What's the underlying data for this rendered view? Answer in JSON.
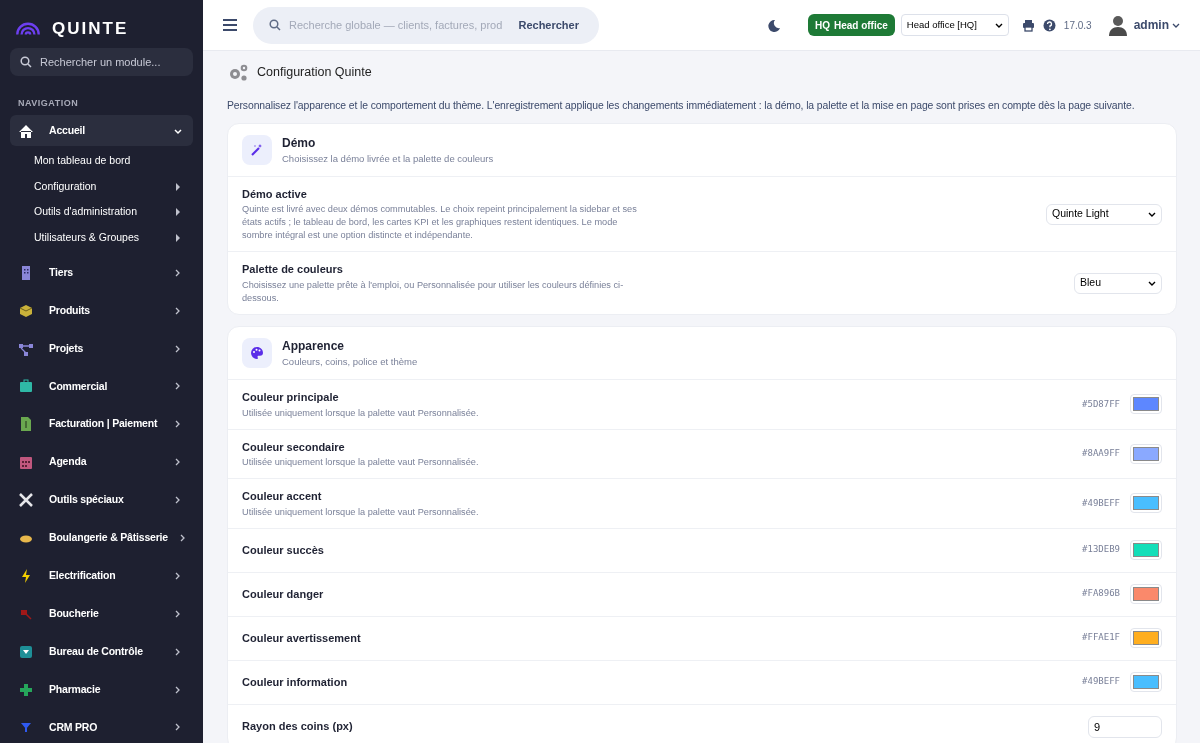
{
  "brand": {
    "name": "QUINTE"
  },
  "sidebar": {
    "search": {
      "placeholder": "Rechercher un module..."
    },
    "section_label": "NAVIGATION",
    "items": [
      {
        "label": "Accueil",
        "selected": true,
        "expanded": true,
        "children": [
          {
            "label": "Mon tableau de bord",
            "has_submenu": false
          },
          {
            "label": "Configuration",
            "has_submenu": true
          },
          {
            "label": "Outils d'administration",
            "has_submenu": true
          },
          {
            "label": "Utilisateurs & Groupes",
            "has_submenu": true
          }
        ]
      },
      {
        "label": "Tiers",
        "selected": false,
        "expanded": false
      },
      {
        "label": "Produits",
        "selected": false,
        "expanded": false
      },
      {
        "label": "Projets",
        "selected": false,
        "expanded": false
      },
      {
        "label": "Commercial",
        "selected": false,
        "expanded": false
      },
      {
        "label": "Facturation | Paiement",
        "selected": false,
        "expanded": false
      },
      {
        "label": "Agenda",
        "selected": false,
        "expanded": false
      },
      {
        "label": "Outils spéciaux",
        "selected": false,
        "expanded": false
      },
      {
        "label": "Boulangerie & Pâtisserie",
        "selected": false,
        "expanded": false
      },
      {
        "label": "Electrification",
        "selected": false,
        "expanded": false
      },
      {
        "label": "Boucherie",
        "selected": false,
        "expanded": false
      },
      {
        "label": "Bureau de Contrôle",
        "selected": false,
        "expanded": false
      },
      {
        "label": "Pharmacie",
        "selected": false,
        "expanded": false
      },
      {
        "label": "CRM PRO",
        "selected": false,
        "expanded": false
      }
    ]
  },
  "topbar": {
    "search": {
      "placeholder": "Recherche globale — clients, factures, prod",
      "button": "Rechercher"
    },
    "entity_badge": {
      "code": "HQ",
      "label": "Head office"
    },
    "entity_select": "Head office [HQ]",
    "version": "17.0.3",
    "user": "admin"
  },
  "page": {
    "title": "Configuration Quinte",
    "intro": "Personnalisez l'apparence et le comportement du thème. L'enregistrement applique les changements immédiatement : la démo, la palette et la mise en page sont prises en compte dès la page suivante.",
    "sections": [
      {
        "title": "Démo",
        "subtitle": "Choisissez la démo livrée et la palette de couleurs",
        "rows": [
          {
            "kind": "select",
            "label": "Démo active",
            "description": "Quinte est livré avec deux démos commutables. Le choix repeint principalement la sidebar et ses états actifs ; le tableau de bord, les cartes KPI et les graphiques restent identiques. Le mode sombre intégral est une option distincte et indépendante.",
            "value": "Quinte Light"
          },
          {
            "kind": "select",
            "label": "Palette de couleurs",
            "description": "Choisissez une palette prête à l'emploi, ou Personnalisée pour utiliser les couleurs définies ci-dessous.",
            "value": "Bleu"
          }
        ]
      },
      {
        "title": "Apparence",
        "subtitle": "Couleurs, coins, police et thème",
        "rows": [
          {
            "kind": "color",
            "label": "Couleur principale",
            "description": "Utilisée uniquement lorsque la palette vaut Personnalisée.",
            "hex": "#5D87FF",
            "color": "#5d87ff"
          },
          {
            "kind": "color",
            "label": "Couleur secondaire",
            "description": "Utilisée uniquement lorsque la palette vaut Personnalisée.",
            "hex": "#8AA9FF",
            "color": "#8aa9ff"
          },
          {
            "kind": "color",
            "label": "Couleur accent",
            "description": "Utilisée uniquement lorsque la palette vaut Personnalisée.",
            "hex": "#49BEFF",
            "color": "#49beff"
          },
          {
            "kind": "color",
            "label": "Couleur succès",
            "hex": "#13DEB9",
            "color": "#13deb9"
          },
          {
            "kind": "color",
            "label": "Couleur danger",
            "hex": "#FA896B",
            "color": "#fa896b"
          },
          {
            "kind": "color",
            "label": "Couleur avertissement",
            "hex": "#FFAE1F",
            "color": "#ffae1f"
          },
          {
            "kind": "color",
            "label": "Couleur information",
            "hex": "#49BEFF",
            "color": "#49beff"
          },
          {
            "kind": "number",
            "label": "Rayon des coins (px)",
            "value": "9"
          }
        ]
      }
    ]
  }
}
